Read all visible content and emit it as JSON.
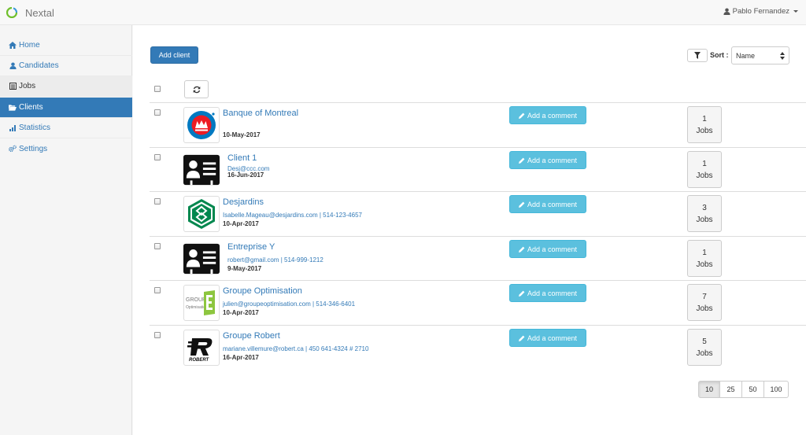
{
  "app": {
    "title": "Nextal",
    "accent": "#337ab7"
  },
  "user": {
    "name": "Pablo Fernandez"
  },
  "sidebar": {
    "items": [
      {
        "label": "Home",
        "icon": "home-icon"
      },
      {
        "label": "Candidates",
        "icon": "user-icon"
      },
      {
        "label": "Jobs",
        "icon": "list-icon"
      },
      {
        "label": "Clients",
        "icon": "folder-open-icon",
        "active": true
      },
      {
        "label": "Statistics",
        "icon": "bar-chart-icon"
      },
      {
        "label": "Settings",
        "icon": "gears-icon"
      }
    ]
  },
  "toolbar": {
    "add_client_label": "Add client",
    "sort_label": "Sort :",
    "sort_value": "Name"
  },
  "clients": [
    {
      "name": "Banque of Montreal",
      "contact": "",
      "date": "10-May-2017",
      "comment_label": "Add a comment",
      "jobs_count": "1",
      "jobs_label": "Jobs",
      "logo": "bmo-logo"
    },
    {
      "name": "Client 1",
      "contact": "Desj@ccc.com",
      "date": "16-Jun-2017",
      "comment_label": "Add a comment",
      "jobs_count": "1",
      "jobs_label": "Jobs",
      "logo": "contact-card-logo"
    },
    {
      "name": "Desjardins",
      "contact": "Isabelle.Mageau@desjardins.com | 514-123-4657",
      "date": "10-Apr-2017",
      "comment_label": "Add a comment",
      "jobs_count": "3",
      "jobs_label": "Jobs",
      "logo": "desjardins-logo"
    },
    {
      "name": "Entreprise Y",
      "contact": "robert@gmail.com | 514-999-1212",
      "date": "9-May-2017",
      "comment_label": "Add a comment",
      "jobs_count": "1",
      "jobs_label": "Jobs",
      "logo": "contact-card-logo"
    },
    {
      "name": "Groupe Optimisation",
      "contact": "julien@groupeoptimisation.com | 514-346-6401",
      "date": "10-Apr-2017",
      "comment_label": "Add a comment",
      "jobs_count": "7",
      "jobs_label": "Jobs",
      "logo": "groupe-optimisation-logo"
    },
    {
      "name": "Groupe Robert",
      "contact": "mariane.villemure@robert.ca | 450 641-4324 # 2710",
      "date": "16-Apr-2017",
      "comment_label": "Add a comment",
      "jobs_count": "5",
      "jobs_label": "Jobs",
      "logo": "robert-logo"
    }
  ],
  "pagination": {
    "options": [
      "10",
      "25",
      "50",
      "100"
    ],
    "selected": "10"
  }
}
